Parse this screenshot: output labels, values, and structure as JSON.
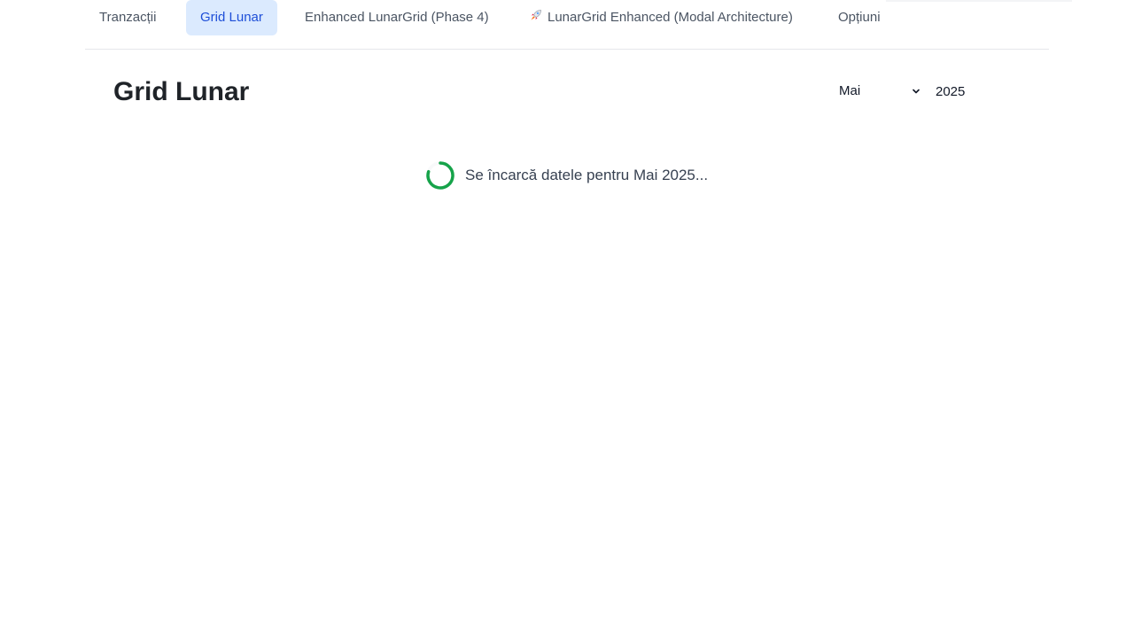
{
  "nav": {
    "tabs": [
      {
        "label": "Tranzacții"
      },
      {
        "label": "Grid Lunar"
      },
      {
        "label": "Enhanced LunarGrid (Phase 4)"
      },
      {
        "label": "LunarGrid Enhanced (Modal Architecture)",
        "icon": "rocket-icon"
      },
      {
        "label": "Opțiuni"
      }
    ],
    "active_tab": "Grid Lunar"
  },
  "page": {
    "title": "Grid Lunar"
  },
  "filters": {
    "month_value": "Mai",
    "year_value": "2025"
  },
  "loading": {
    "text": "Se încarcă datele pentru Mai 2025..."
  },
  "colors": {
    "active_tab_bg": "#dbeafe",
    "active_tab_text": "#1d4ed8",
    "spinner": "#16a34a"
  }
}
